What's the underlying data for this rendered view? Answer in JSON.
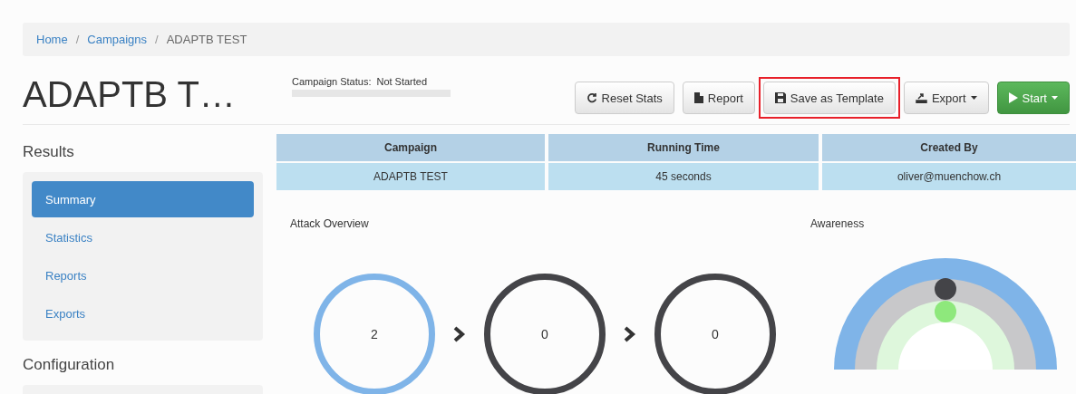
{
  "breadcrumb": [
    {
      "label": "Home",
      "kind": "link"
    },
    {
      "label": "/",
      "kind": "separator"
    },
    {
      "label": "Campaigns",
      "kind": "link"
    },
    {
      "label": "/",
      "kind": "separator"
    },
    {
      "label": "ADAPTB TEST",
      "kind": "current"
    }
  ],
  "title": "ADAPTB T…",
  "status": {
    "label": "Campaign Status:",
    "value": "Not Started",
    "level": 0
  },
  "buttons": [
    {
      "label": "Reset Stats",
      "kind": "refresh",
      "highlighted": false
    },
    {
      "label": "Report",
      "kind": "file",
      "highlighted": false
    },
    {
      "label": "Save as Template",
      "kind": "save",
      "highlighted": true
    },
    {
      "label": "Export",
      "kind": "export",
      "highlighted": false
    },
    {
      "label": "Start",
      "kind": "start",
      "highlighted": false
    }
  ],
  "sidebar": {
    "sections": [
      {
        "heading": "Results",
        "items": [
          {
            "label": "Summary",
            "selected": true
          },
          {
            "label": "Statistics",
            "selected": false
          },
          {
            "label": "Reports",
            "selected": false
          },
          {
            "label": "Exports",
            "selected": false
          }
        ]
      },
      {
        "heading": "Configuration"
      }
    ]
  },
  "table": {
    "columns": [
      "Campaign",
      "Running Time",
      "Created By"
    ],
    "rows": [
      [
        "ADAPTB TEST",
        "45 seconds",
        "oliver@muenchow.ch"
      ]
    ]
  },
  "attack_overview": {
    "title": "Attack Overview",
    "stages": [
      {
        "count": "2",
        "color": "#7fb4e8"
      },
      {
        "count": "0",
        "color": "#444448"
      },
      {
        "count": "0",
        "color": "#444448"
      }
    ]
  },
  "awareness": {
    "title": "Awareness"
  }
}
